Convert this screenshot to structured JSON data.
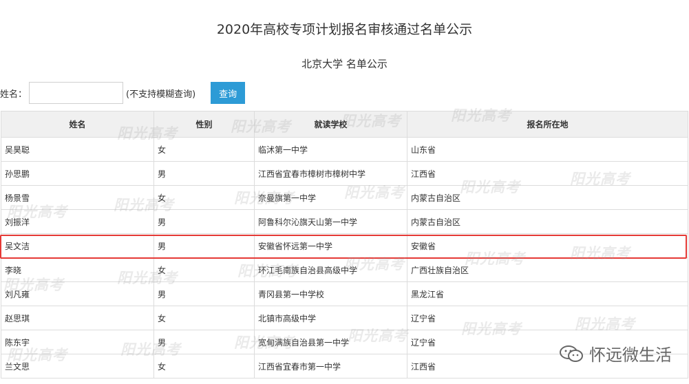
{
  "header": {
    "title": "2020年高校专项计划报名审核通过名单公示",
    "subtitle": "北京大学 名单公示"
  },
  "search": {
    "label": "姓名：",
    "value": "",
    "hint": "(不支持模糊查询)",
    "button_label": "查询"
  },
  "table": {
    "headers": [
      "姓名",
      "性别",
      "就读学校",
      "报名所在地"
    ],
    "rows": [
      [
        "吴昊聪",
        "女",
        "临沭第一中学",
        "山东省"
      ],
      [
        "孙思鹏",
        "男",
        "江西省宜春市樟树市樟树中学",
        "江西省"
      ],
      [
        "杨景雪",
        "女",
        "奈曼旗第一中学",
        "内蒙古自治区"
      ],
      [
        "刘振洋",
        "男",
        "阿鲁科尔沁旗天山第一中学",
        "内蒙古自治区"
      ],
      [
        "吴文洁",
        "男",
        "安徽省怀远第一中学",
        "安徽省"
      ],
      [
        "李晓",
        "女",
        "环江毛南族自治县高级中学",
        "广西壮族自治区"
      ],
      [
        "刘凡雍",
        "男",
        "青冈县第一中学校",
        "黑龙江省"
      ],
      [
        "赵思琪",
        "女",
        "北镇市高级中学",
        "辽宁省"
      ],
      [
        "陈东宇",
        "男",
        "宽甸满族自治县第一中学",
        "辽宁省"
      ],
      [
        "兰文思",
        "女",
        "江西省宜春市第一中学",
        "江西省"
      ]
    ],
    "highlighted_row": 4
  },
  "watermark_text": "阳光高考",
  "brand": {
    "label": "怀远微生活",
    "icon": "wechat-icon"
  },
  "colors": {
    "button": "#2d9bd6",
    "highlight": "#e53935",
    "header_bg": "#f0f0f0"
  }
}
